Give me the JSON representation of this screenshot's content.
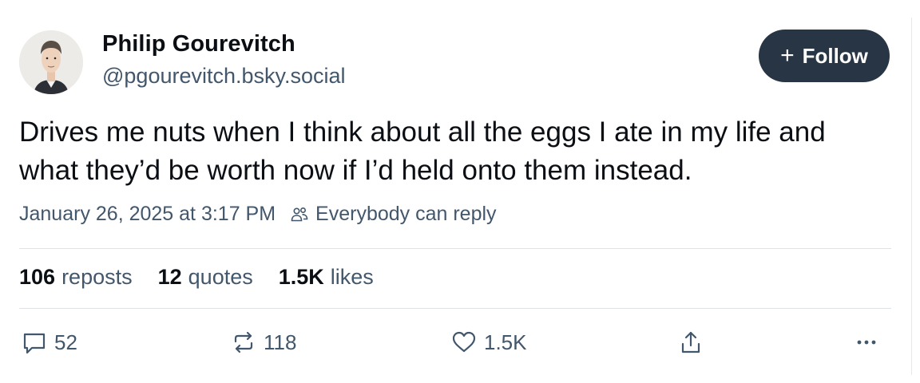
{
  "author": {
    "name": "Philip Gourevitch",
    "handle": "@pgourevitch.bsky.social"
  },
  "follow_button": {
    "icon": "+",
    "label": "Follow"
  },
  "post": {
    "line1": "Drives me nuts when I think about all the eggs I ate in my life and",
    "line2": "what they’d be worth now if I’d held onto them instead.",
    "timestamp": "January 26, 2025 at 3:17 PM",
    "reply_setting": "Everybody can reply"
  },
  "stats": {
    "reposts_count": "106",
    "reposts_label": "reposts",
    "quotes_count": "12",
    "quotes_label": "quotes",
    "likes_count": "1.5K",
    "likes_label": "likes"
  },
  "actions": {
    "reply_count": "52",
    "repost_count": "118",
    "like_count": "1.5K"
  },
  "colors": {
    "text_primary": "#0b0f14",
    "text_secondary": "#42576c",
    "follow_bg": "#283544",
    "divider": "#dfe3e8"
  }
}
